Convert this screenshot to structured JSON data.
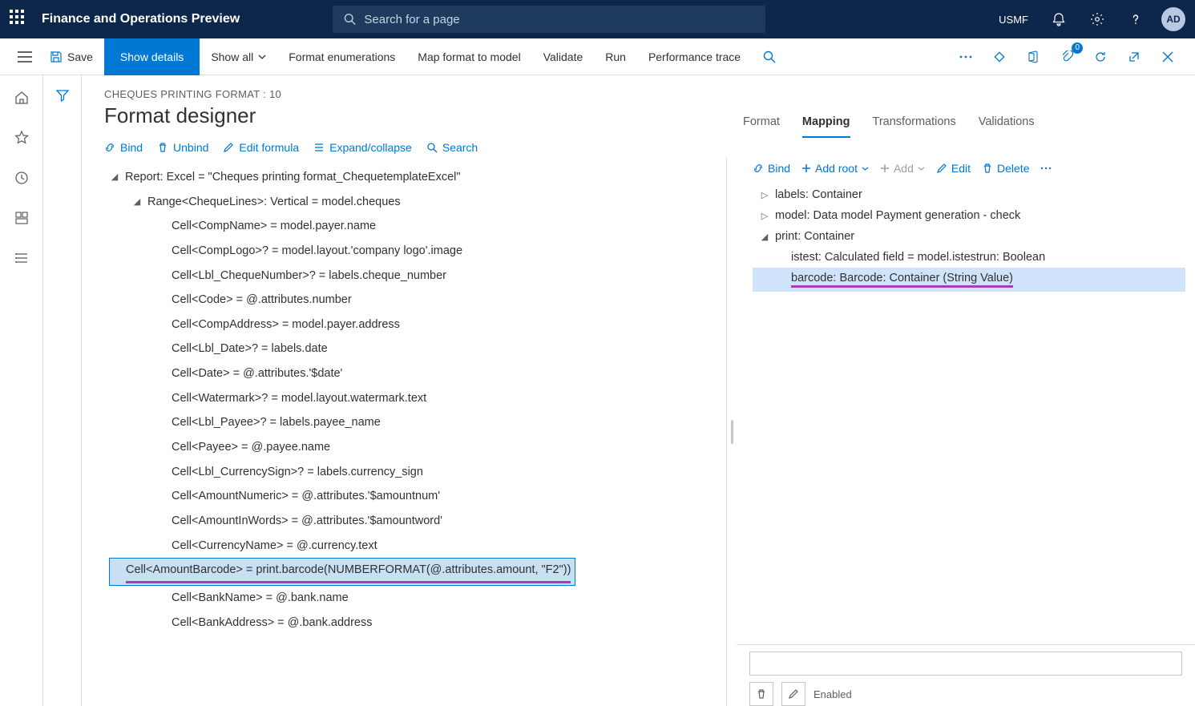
{
  "topbar": {
    "app_title": "Finance and Operations Preview",
    "search_placeholder": "Search for a page",
    "company": "USMF",
    "avatar_initials": "AD"
  },
  "actionbar": {
    "save": "Save",
    "show_details": "Show details",
    "show_all": "Show all",
    "format_enum": "Format enumerations",
    "map_format": "Map format to model",
    "validate": "Validate",
    "run": "Run",
    "perf_trace": "Performance trace",
    "badge_count": "0"
  },
  "page": {
    "breadcrumb": "CHEQUES PRINTING FORMAT : 10",
    "title": "Format designer"
  },
  "left_toolbar": {
    "bind": "Bind",
    "unbind": "Unbind",
    "edit_formula": "Edit formula",
    "expand_collapse": "Expand/collapse",
    "search": "Search"
  },
  "format_tree": {
    "root": "Report: Excel = \"Cheques printing format_ChequetemplateExcel\"",
    "range": "Range<ChequeLines>: Vertical = model.cheques",
    "cells": [
      "Cell<CompName> = model.payer.name",
      "Cell<CompLogo>? = model.layout.'company logo'.image",
      "Cell<Lbl_ChequeNumber>? = labels.cheque_number",
      "Cell<Code> = @.attributes.number",
      "Cell<CompAddress> = model.payer.address",
      "Cell<Lbl_Date>? = labels.date",
      "Cell<Date> = @.attributes.'$date'",
      "Cell<Watermark>? = model.layout.watermark.text",
      "Cell<Lbl_Payee>? = labels.payee_name",
      "Cell<Payee> = @.payee.name",
      "Cell<Lbl_CurrencySign>? = labels.currency_sign",
      "Cell<AmountNumeric> = @.attributes.'$amountnum'",
      "Cell<AmountInWords> = @.attributes.'$amountword'",
      "Cell<CurrencyName> = @.currency.text",
      "Cell<AmountBarcode> = print.barcode(NUMBERFORMAT(@.attributes.amount, \"F2\"))",
      "Cell<BankName> = @.bank.name",
      "Cell<BankAddress> = @.bank.address"
    ],
    "selected_index": 14
  },
  "right_tabs": {
    "format": "Format",
    "mapping": "Mapping",
    "transformations": "Transformations",
    "validations": "Validations"
  },
  "right_toolbar": {
    "bind": "Bind",
    "add_root": "Add root",
    "add": "Add",
    "edit": "Edit",
    "delete": "Delete"
  },
  "mapping_tree": {
    "labels": "labels: Container",
    "model": "model: Data model Payment generation - check",
    "print": "print: Container",
    "istest": "istest: Calculated field = model.istestrun: Boolean",
    "barcode": "barcode: Barcode: Container (String Value)"
  },
  "bottom": {
    "enabled": "Enabled"
  }
}
